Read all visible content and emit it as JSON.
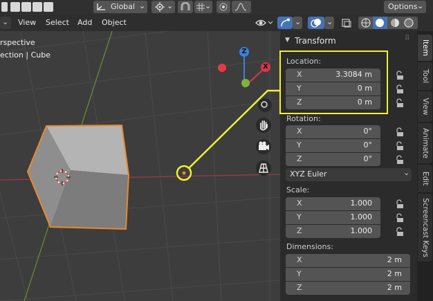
{
  "top_header": {
    "transform_orientation": "Global",
    "options_label": "Options"
  },
  "view_header": {
    "menus": [
      "View",
      "Select",
      "Add",
      "Object"
    ]
  },
  "viewport": {
    "overlay_line1": "rspective",
    "overlay_line2": "ection | Cube",
    "gizmo": {
      "z": "Z",
      "x": "X"
    }
  },
  "npanel": {
    "title": "Transform",
    "location": {
      "label": "Location:",
      "x": {
        "axis": "X",
        "value": "3.3084 m"
      },
      "y": {
        "axis": "Y",
        "value": "0 m"
      },
      "z": {
        "axis": "Z",
        "value": "0 m"
      }
    },
    "rotation": {
      "label": "Rotation:",
      "x": {
        "axis": "X",
        "value": "0°"
      },
      "y": {
        "axis": "Y",
        "value": "0°"
      },
      "z": {
        "axis": "Z",
        "value": "0°"
      },
      "mode": "XYZ Euler"
    },
    "scale": {
      "label": "Scale:",
      "x": {
        "axis": "X",
        "value": "1.000"
      },
      "y": {
        "axis": "Y",
        "value": "1.000"
      },
      "z": {
        "axis": "Z",
        "value": "1.000"
      }
    },
    "dimensions": {
      "label": "Dimensions:",
      "x": {
        "axis": "X",
        "value": "2 m"
      },
      "y": {
        "axis": "Y",
        "value": "2 m"
      },
      "z": {
        "axis": "Z",
        "value": "2 m"
      }
    }
  },
  "tabs": [
    "Item",
    "Tool",
    "View",
    "Animate",
    "Edit",
    "Screencast Keys"
  ],
  "colors": {
    "highlight": "#f2f230",
    "selection": "#e8892a",
    "x_axis": "#d8374a",
    "y_axis": "#7fb53a",
    "z_axis": "#3a82e0"
  }
}
